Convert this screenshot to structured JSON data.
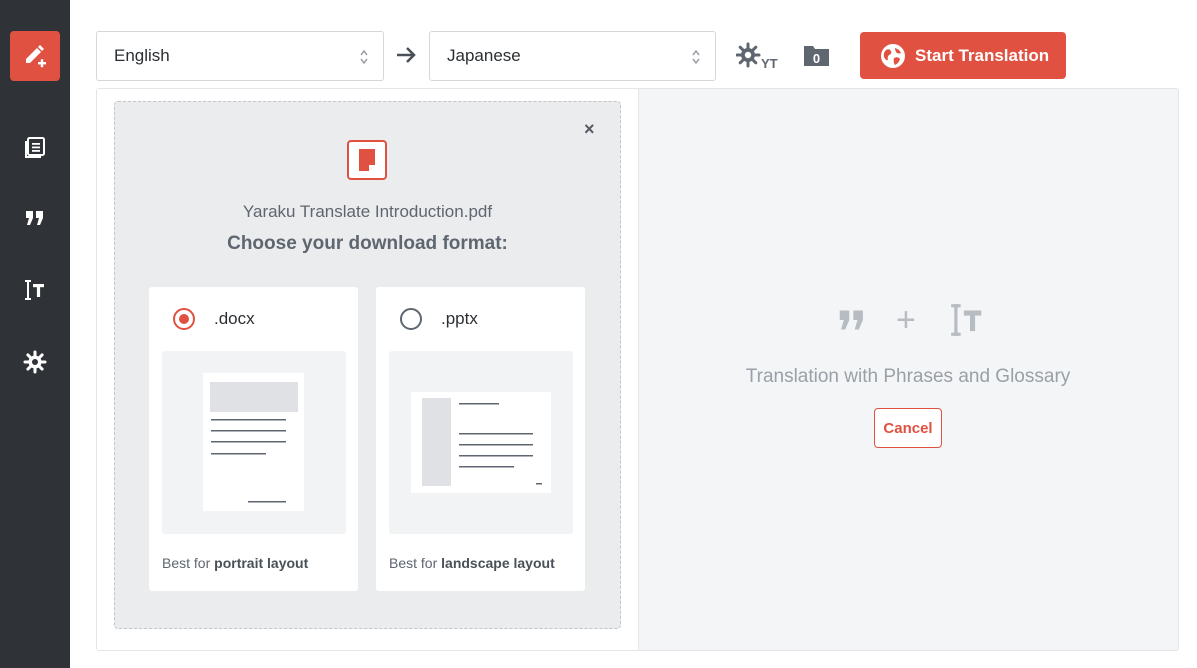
{
  "toolbar": {
    "source_language": "English",
    "target_language": "Japanese",
    "yt_badge": "YT",
    "folder_count": "0",
    "start_label": "Start Translation"
  },
  "dialog": {
    "close_glyph": "×",
    "filename": "Yaraku Translate Introduction.pdf",
    "heading": "Choose your download format:",
    "options": [
      {
        "label": ".docx",
        "note_prefix": "Best for ",
        "note_bold": "portrait layout",
        "selected": true
      },
      {
        "label": ".pptx",
        "note_prefix": "Best for ",
        "note_bold": "landscape layout",
        "selected": false
      }
    ]
  },
  "right_panel": {
    "plus": "+",
    "caption": "Translation with Phrases and Glossary",
    "cancel_label": "Cancel"
  },
  "colors": {
    "accent": "#e05141",
    "sidebar_bg": "#2f3237",
    "muted_text": "#9aa0a7"
  },
  "icons": {
    "sidebar": [
      "pencil-plus-icon",
      "documents-icon",
      "quote-icon",
      "glossary-icon",
      "gear-icon"
    ],
    "toolbar": [
      "arrow-right-icon",
      "gear-yt-icon",
      "folder-icon",
      "globe-icon"
    ]
  }
}
